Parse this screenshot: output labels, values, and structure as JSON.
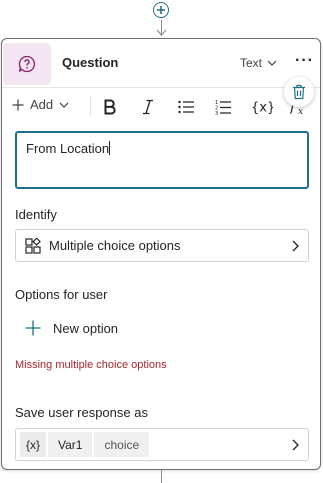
{
  "header": {
    "title": "Question",
    "type_select": "Text"
  },
  "toolbar": {
    "add_label": "Add"
  },
  "message": {
    "text": "From Location"
  },
  "identify": {
    "label": "Identify",
    "value": "Multiple choice options"
  },
  "options": {
    "label": "Options for user",
    "new_option_label": "New option",
    "error": "Missing multiple choice options"
  },
  "save": {
    "label": "Save user response as",
    "var_tag": "{x}",
    "var_name": "Var1",
    "var_type": "choice"
  },
  "icons": [
    "plus-icon",
    "question-icon",
    "chevron-down-icon",
    "more-icon",
    "bold-icon",
    "italic-icon",
    "bullet-list-icon",
    "numbered-list-icon",
    "variable-icon",
    "formula-icon",
    "trash-icon",
    "choice-options-icon",
    "chevron-right-icon"
  ],
  "colors": {
    "accent": "#1f6f86",
    "icon_bg": "#f3e5f1",
    "error": "#a4262c"
  }
}
